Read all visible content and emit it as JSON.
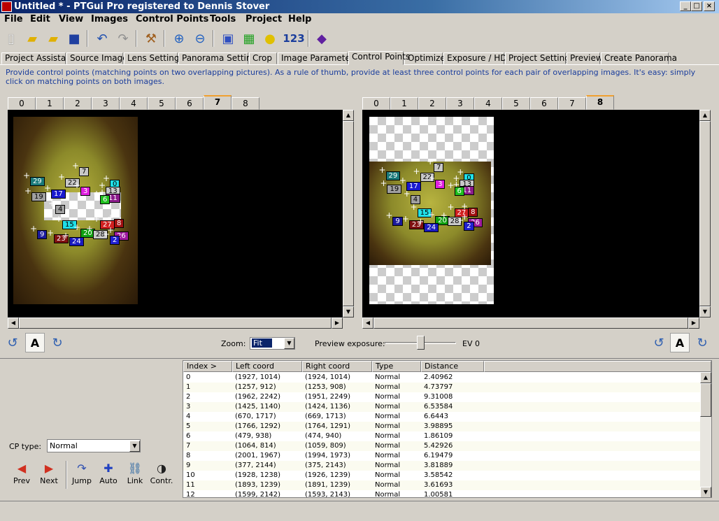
{
  "window": {
    "title": "Untitled * - PTGui Pro registered to Dennis Stover"
  },
  "menu": [
    "File",
    "Edit",
    "View",
    "Images",
    "Control Points",
    "Tools",
    "Project",
    "Help"
  ],
  "toolbar": {
    "batch_label": "123"
  },
  "tabs": [
    "Project Assistant",
    "Source Images",
    "Lens Settings",
    "Panorama Settings",
    "Crop",
    "Image Parameters",
    "Control Points",
    "Optimizer",
    "Exposure / HDR",
    "Project Settings",
    "Preview",
    "Create Panorama"
  ],
  "active_tab": "Control Points",
  "hint": "Provide control points (matching points on two overlapping pictures). As a rule of thumb, provide at least three control points for each pair of overlapping images. It's easy: simply click on matching points on both images.",
  "left_image_tabs": [
    "0",
    "1",
    "2",
    "3",
    "4",
    "5",
    "6",
    "7",
    "8"
  ],
  "left_active": "7",
  "right_image_tabs": [
    "0",
    "1",
    "2",
    "3",
    "4",
    "5",
    "6",
    "7",
    "8"
  ],
  "right_active": "8",
  "controls": {
    "zoom_label": "Zoom:",
    "zoom_value": "Fit",
    "exposure_label": "Preview exposure:",
    "exposure_value": "EV 0",
    "auto_letter": "A"
  },
  "cp_type": {
    "label": "CP type:",
    "value": "Normal"
  },
  "buttons": {
    "prev": "Prev",
    "next": "Next",
    "jump": "Jump",
    "auto": "Auto",
    "link": "Link",
    "contr": "Contr."
  },
  "table": {
    "headers": [
      "Index >",
      "Left coord",
      "Right coord",
      "Type",
      "Distance"
    ],
    "rows": [
      [
        "0",
        "(1927, 1014)",
        "(1924, 1014)",
        "Normal",
        "2.40962"
      ],
      [
        "1",
        "(1257, 912)",
        "(1253, 908)",
        "Normal",
        "4.73797"
      ],
      [
        "2",
        "(1962, 2242)",
        "(1951, 2249)",
        "Normal",
        "9.31008"
      ],
      [
        "3",
        "(1425, 1140)",
        "(1424, 1136)",
        "Normal",
        "6.53584"
      ],
      [
        "4",
        "(670, 1717)",
        "(669, 1713)",
        "Normal",
        "6.6443"
      ],
      [
        "5",
        "(1766, 1292)",
        "(1764, 1291)",
        "Normal",
        "3.98895"
      ],
      [
        "6",
        "(479, 938)",
        "(474, 940)",
        "Normal",
        "1.86109"
      ],
      [
        "7",
        "(1064, 814)",
        "(1059, 809)",
        "Normal",
        "5.42926"
      ],
      [
        "8",
        "(2001, 1967)",
        "(1994, 1973)",
        "Normal",
        "6.19479"
      ],
      [
        "9",
        "(377, 2144)",
        "(375, 2143)",
        "Normal",
        "3.81889"
      ],
      [
        "10",
        "(1928, 1238)",
        "(1926, 1239)",
        "Normal",
        "3.58542"
      ],
      [
        "11",
        "(1893, 1239)",
        "(1891, 1239)",
        "Normal",
        "3.61693"
      ],
      [
        "12",
        "(1599, 2142)",
        "(1593, 2143)",
        "Normal",
        "1.00581"
      ]
    ]
  },
  "cp_labels": [
    {
      "n": "7",
      "color": "#c8c8c8"
    },
    {
      "n": "29",
      "color": "#1a7a7a"
    },
    {
      "n": "22",
      "color": "#c8c8c8"
    },
    {
      "n": "0",
      "color": "#20e0e8"
    },
    {
      "n": "17",
      "color": "#1a1ad0"
    },
    {
      "n": "3",
      "color": "#e020e0"
    },
    {
      "n": "13",
      "color": "#c8c8c8"
    },
    {
      "n": "19",
      "color": "#a0a0a0"
    },
    {
      "n": "11",
      "color": "#8a1a8a"
    },
    {
      "n": "4",
      "color": "#a0a0a0"
    },
    {
      "n": "15",
      "color": "#20e0e8"
    },
    {
      "n": "27",
      "color": "#d02020"
    },
    {
      "n": "8",
      "color": "#a01010"
    },
    {
      "n": "9",
      "color": "#1a1a9a"
    },
    {
      "n": "20",
      "color": "#10a010"
    },
    {
      "n": "28",
      "color": "#c8c8c8"
    },
    {
      "n": "26",
      "color": "#a01aa0"
    },
    {
      "n": "23",
      "color": "#801010"
    },
    {
      "n": "24",
      "color": "#1a1ac0"
    },
    {
      "n": "2",
      "color": "#2020d0"
    },
    {
      "n": "6",
      "color": "#20c020"
    }
  ]
}
